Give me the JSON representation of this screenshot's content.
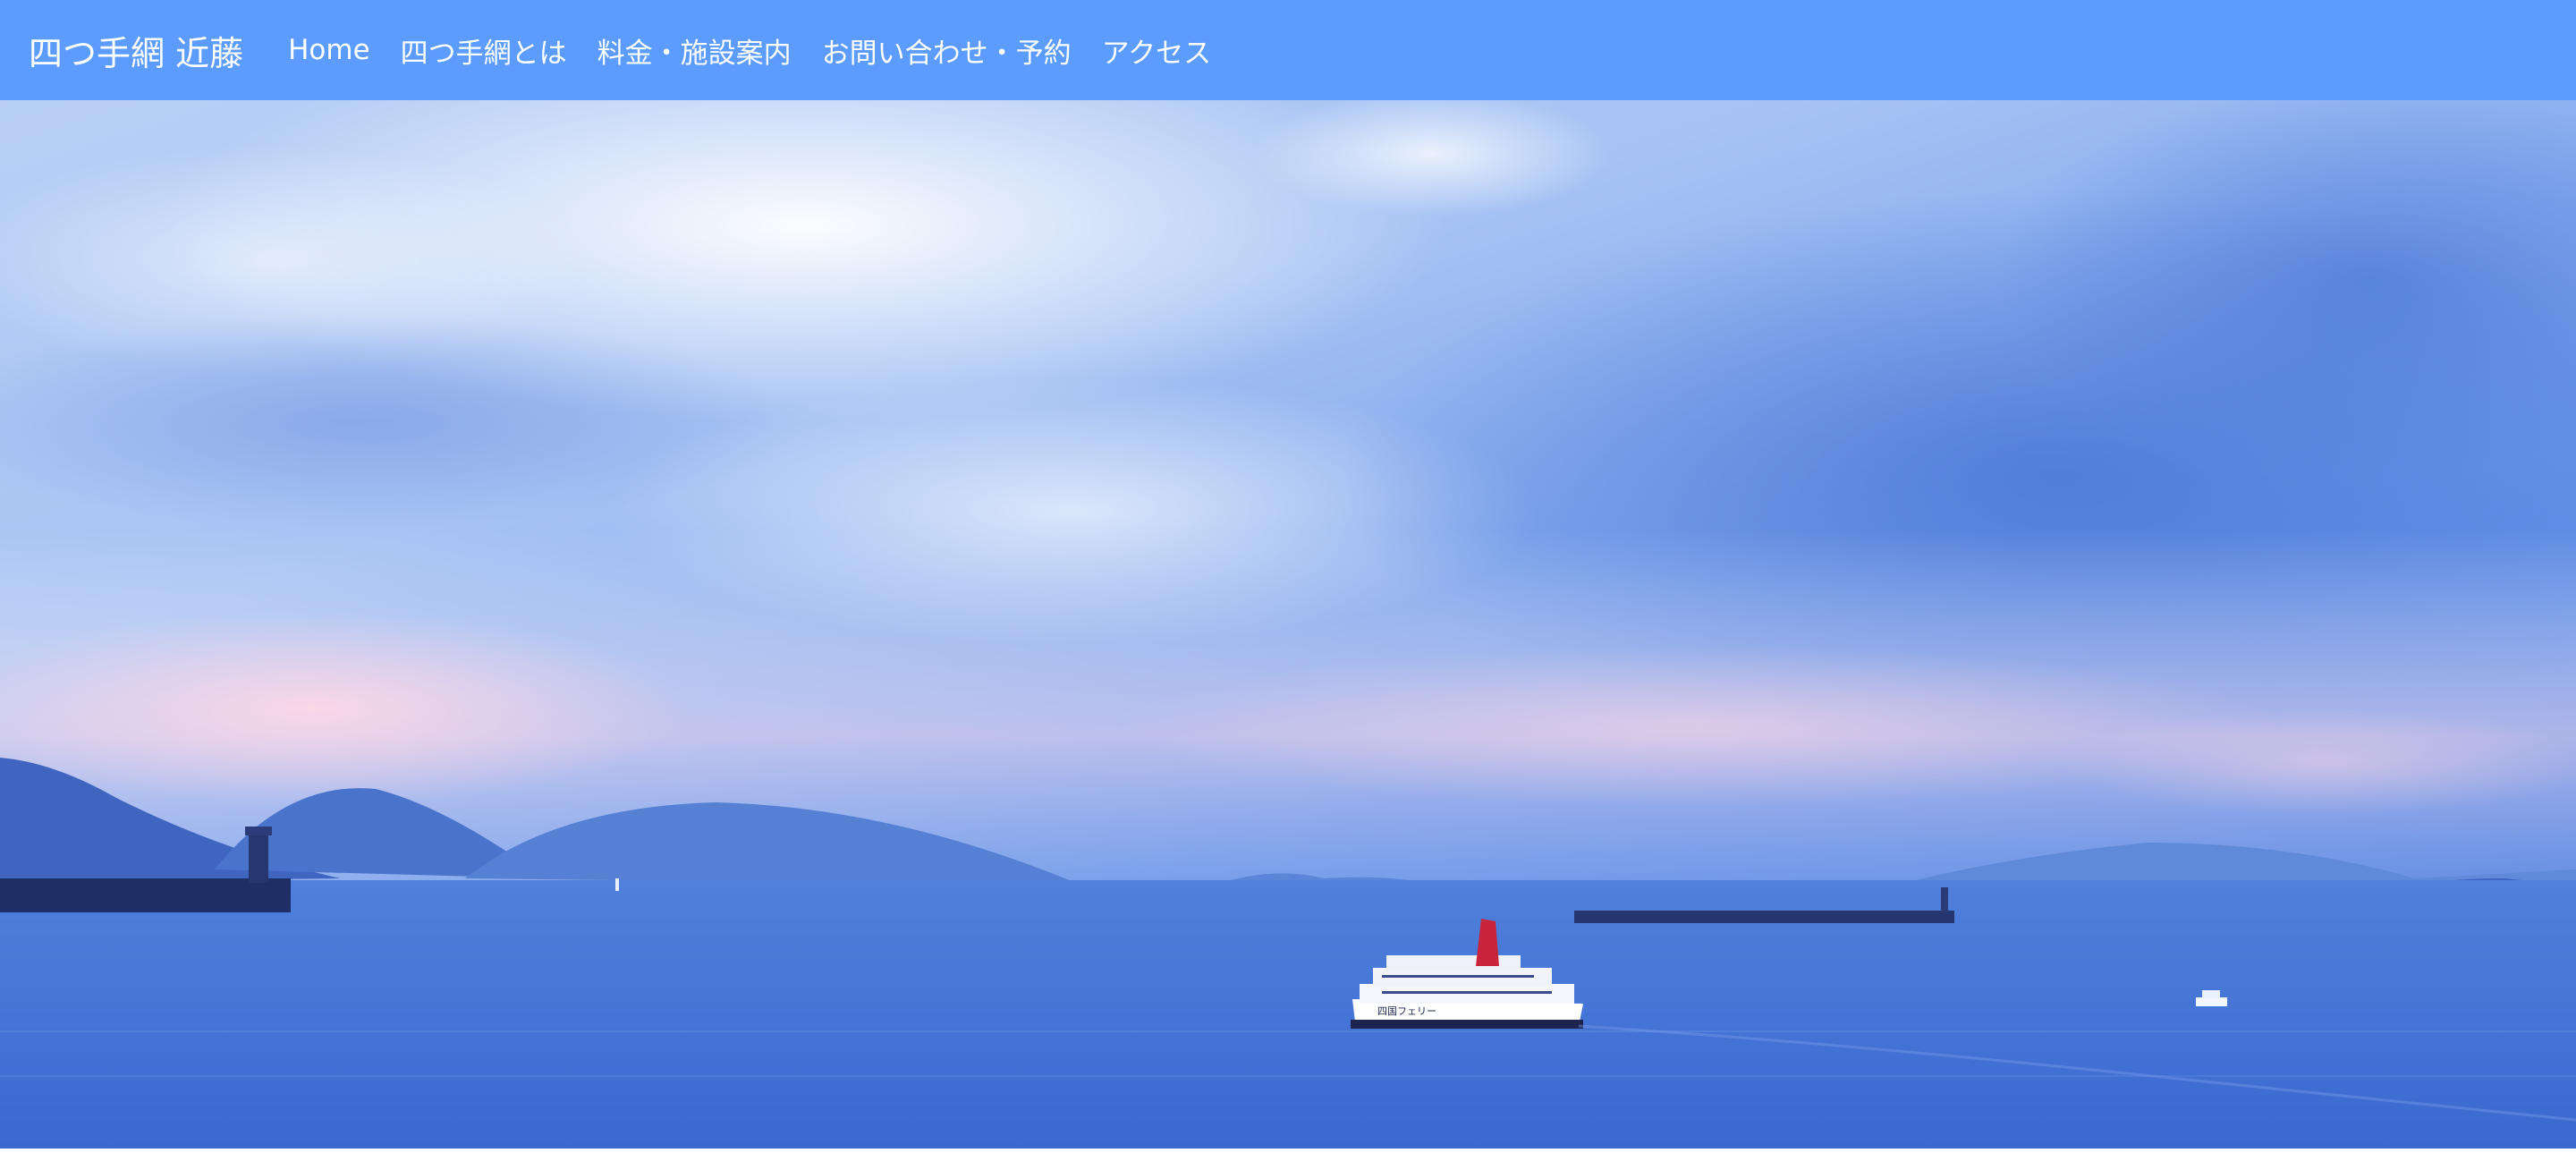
{
  "header": {
    "brand": "四つ手網 近藤",
    "nav": [
      {
        "label": "Home"
      },
      {
        "label": "四つ手網とは"
      },
      {
        "label": "料金・施設案内"
      },
      {
        "label": "お問い合わせ・予約"
      },
      {
        "label": "アクセス"
      }
    ]
  },
  "hero": {
    "ferry_text": "四国フェリー"
  },
  "colors": {
    "navbar": "#5c9cff",
    "sea": "#3d6fd4",
    "sky_top": "#8fb4f2"
  }
}
